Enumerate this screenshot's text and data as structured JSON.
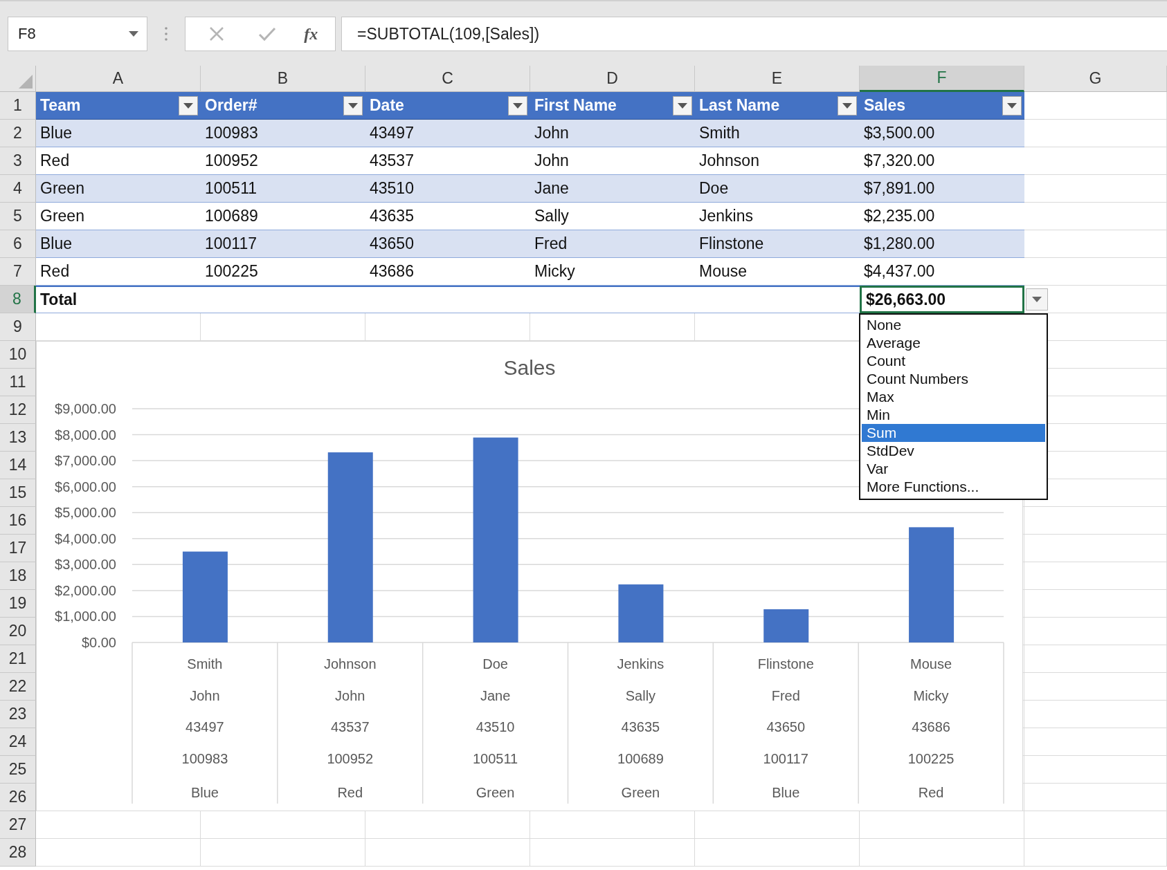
{
  "formula_bar": {
    "name_box": "F8",
    "cancel_disabled": true,
    "enter_disabled": true,
    "function_label": "fx",
    "formula": "=SUBTOTAL(109,[Sales])"
  },
  "columns": [
    {
      "label": "A",
      "selected": false
    },
    {
      "label": "B",
      "selected": false
    },
    {
      "label": "C",
      "selected": false
    },
    {
      "label": "D",
      "selected": false
    },
    {
      "label": "E",
      "selected": false
    },
    {
      "label": "F",
      "selected": true
    },
    {
      "label": "G",
      "selected": false
    }
  ],
  "rows": [
    {
      "label": "1",
      "selected": false
    },
    {
      "label": "2",
      "selected": false
    },
    {
      "label": "3",
      "selected": false
    },
    {
      "label": "4",
      "selected": false
    },
    {
      "label": "5",
      "selected": false
    },
    {
      "label": "6",
      "selected": false
    },
    {
      "label": "7",
      "selected": false
    },
    {
      "label": "8",
      "selected": true
    },
    {
      "label": "9",
      "selected": false
    },
    {
      "label": "10",
      "selected": false
    },
    {
      "label": "11",
      "selected": false
    },
    {
      "label": "12",
      "selected": false
    },
    {
      "label": "13",
      "selected": false
    },
    {
      "label": "14",
      "selected": false
    },
    {
      "label": "15",
      "selected": false
    },
    {
      "label": "16",
      "selected": false
    },
    {
      "label": "17",
      "selected": false
    },
    {
      "label": "18",
      "selected": false
    },
    {
      "label": "19",
      "selected": false
    },
    {
      "label": "20",
      "selected": false
    },
    {
      "label": "21",
      "selected": false
    },
    {
      "label": "22",
      "selected": false
    },
    {
      "label": "23",
      "selected": false
    },
    {
      "label": "24",
      "selected": false
    },
    {
      "label": "25",
      "selected": false
    },
    {
      "label": "26",
      "selected": false
    },
    {
      "label": "27",
      "selected": false
    },
    {
      "label": "28",
      "selected": false
    }
  ],
  "table": {
    "headers": [
      "Team",
      "Order#",
      "Date",
      "First Name",
      "Last Name",
      "Sales"
    ],
    "rows": [
      [
        "Blue",
        "100983",
        "43497",
        "John",
        "Smith",
        "$3,500.00"
      ],
      [
        "Red",
        "100952",
        "43537",
        "John",
        "Johnson",
        "$7,320.00"
      ],
      [
        "Green",
        "100511",
        "43510",
        "Jane",
        "Doe",
        "$7,891.00"
      ],
      [
        "Green",
        "100689",
        "43635",
        "Sally",
        "Jenkins",
        "$2,235.00"
      ],
      [
        "Blue",
        "100117",
        "43650",
        "Fred",
        "Flinstone",
        "$1,280.00"
      ],
      [
        "Red",
        "100225",
        "43686",
        "Micky",
        "Mouse",
        "$4,437.00"
      ]
    ],
    "total": {
      "label": "Total",
      "value": "$26,663.00"
    }
  },
  "total_menu": {
    "items": [
      {
        "label": "None",
        "selected": false
      },
      {
        "label": "Average",
        "selected": false
      },
      {
        "label": "Count",
        "selected": false
      },
      {
        "label": "Count Numbers",
        "selected": false
      },
      {
        "label": "Max",
        "selected": false
      },
      {
        "label": "Min",
        "selected": false
      },
      {
        "label": "Sum",
        "selected": true
      },
      {
        "label": "StdDev",
        "selected": false
      },
      {
        "label": "Var",
        "selected": false
      },
      {
        "label": "More Functions...",
        "selected": false
      }
    ]
  },
  "chart": {
    "chart_data": {
      "type": "bar",
      "title": "Sales",
      "categories": [
        [
          "Smith",
          "John",
          "43497",
          "100983",
          "Blue"
        ],
        [
          "Johnson",
          "John",
          "43537",
          "100952",
          "Red"
        ],
        [
          "Doe",
          "Jane",
          "43510",
          "100511",
          "Green"
        ],
        [
          "Jenkins",
          "Sally",
          "43635",
          "100689",
          "Green"
        ],
        [
          "Flinstone",
          "Fred",
          "43650",
          "100117",
          "Blue"
        ],
        [
          "Mouse",
          "Micky",
          "43686",
          "100225",
          "Red"
        ]
      ],
      "series": [
        {
          "color": "#4472c4",
          "values": [
            3500,
            7320,
            7891,
            2235,
            1280,
            4437
          ]
        }
      ],
      "grid": true,
      "ylim": [
        0,
        9000
      ],
      "yticks": [
        {
          "value": 0,
          "label": "$0.00"
        },
        {
          "value": 1000,
          "label": "$1,000.00"
        },
        {
          "value": 2000,
          "label": "$2,000.00"
        },
        {
          "value": 3000,
          "label": "$3,000.00"
        },
        {
          "value": 4000,
          "label": "$4,000.00"
        },
        {
          "value": 5000,
          "label": "$5,000.00"
        },
        {
          "value": 6000,
          "label": "$6,000.00"
        },
        {
          "value": 7000,
          "label": "$7,000.00"
        },
        {
          "value": 8000,
          "label": "$8,000.00"
        },
        {
          "value": 9000,
          "label": "$9,000.00"
        }
      ]
    }
  }
}
